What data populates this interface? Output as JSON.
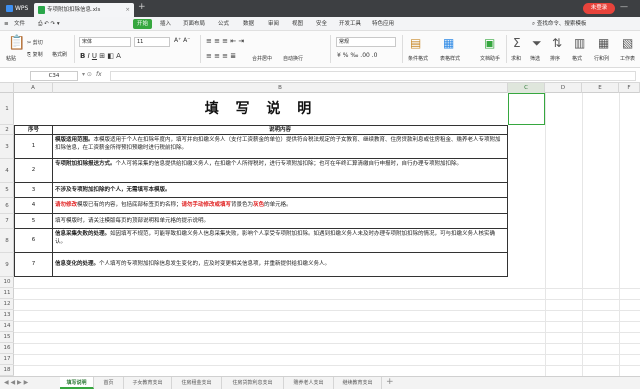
{
  "titlebar": {
    "app_label": "WPS",
    "doc_tab": "专项附加扣除信息.xls",
    "new_tab": "+",
    "login": "未登录",
    "controls": [
      "—",
      "❐",
      "✕"
    ]
  },
  "menubar": {
    "file": "文件",
    "items": [
      "开始",
      "插入",
      "页面布局",
      "公式",
      "数据",
      "审阅",
      "视图",
      "安全",
      "开发工具",
      "特色应用"
    ],
    "search": "查找命令、搜索模板"
  },
  "toolbar": {
    "cut": "剪切",
    "copy": "复制",
    "paste": "粘贴",
    "format_painter": "格式刷",
    "font_name": "宋体",
    "font_size": "11",
    "merge_center": "合并居中",
    "wrap": "自动换行",
    "number_format": "常规",
    "cond_format": "条件格式",
    "table_style": "表格样式",
    "doc_helper": "文档助手",
    "sum": "求和",
    "filter": "筛选",
    "sort": "排序",
    "format": "格式",
    "rows_cols": "行和列",
    "worksheet": "工作表"
  },
  "formulabar": {
    "cell_ref": "C34",
    "fx": "fx",
    "value": ""
  },
  "columns": [
    "A",
    "B",
    "C",
    "D",
    "E",
    "F"
  ],
  "rows": [
    "1",
    "2",
    "3",
    "4",
    "5",
    "6",
    "7",
    "8",
    "9",
    "10",
    "11",
    "12",
    "13",
    "14",
    "15",
    "16",
    "17",
    "18",
    "19",
    "20",
    "21",
    "22",
    "23",
    "24",
    "25"
  ],
  "sheet": {
    "title": "填 写 说 明",
    "header_num": "序号",
    "header_content": "说明内容",
    "items": [
      {
        "num": "1",
        "lead": "模版适用范围。",
        "text": "本模版适用于个人在扣除年度内，填写并向扣缴义务人（支付工资薪金的单位）提供符合税法规定的子女教育、继续教育、住房贷款利息或住房租金、赡养老人专项附加扣除信息，在工资薪金所得预扣预缴时进行税前扣除。"
      },
      {
        "num": "2",
        "lead": "专项附加扣除报送方式。",
        "text": "个人可将采集的信息提供给扣缴义务人，在扣缴个人所得税时，进行专项附加扣除；也可在年终汇算清缴自行申报时，自行办理专项附加扣除。"
      },
      {
        "num": "3",
        "lead": "不涉及专项附加扣除的个人，无需填写本模版。",
        "text": ""
      },
      {
        "num": "4",
        "pre_red": "请勿修改",
        "mid": "模版已有的内容，包括底部标签页的名称；",
        "red2": "请勿手动修改或填写",
        "post": "背景色为",
        "red3": "灰色",
        "tail": "的单元格。"
      },
      {
        "num": "5",
        "lead": "",
        "text": "填写模版时，请关注模版每页的顶部说明和单元格的提示说明。"
      },
      {
        "num": "6",
        "lead": "信息采集失败的处理。",
        "text": "如因填写不规范，可能导致扣缴义务人信息采集失败，影响个人享受专项附加扣除。如遇到扣缴义务人未及时办理专项附加扣除的情况，可与扣缴义务人核实确认。"
      },
      {
        "num": "7",
        "lead": "信息变化的处理。",
        "text": "个人填写的专项附加扣除信息发生变化的，应及时变更相关信息项，并重新提供给扣缴义务人。"
      }
    ]
  },
  "sheet_tabs": [
    "填写说明",
    "首页",
    "子女教育支出",
    "住房租金支出",
    "住房贷款利息支出",
    "赡养老人支出",
    "继续教育支出"
  ],
  "sheet_add": "+",
  "colors": {
    "accent": "#36a73f",
    "titlebar": "#3d3f42",
    "red": "#e02020"
  }
}
